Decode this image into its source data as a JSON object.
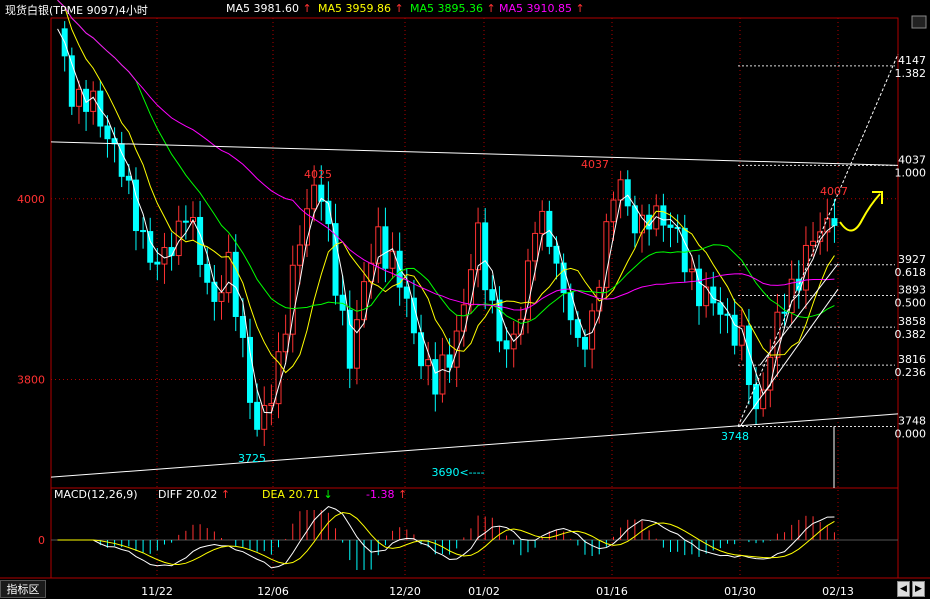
{
  "title": "现货白银(TPME 9097)4小时",
  "ma_readouts": [
    {
      "label": "MA5 3981.60",
      "color": "#ffffff"
    },
    {
      "label": "MA5 3959.86",
      "color": "#ffff00"
    },
    {
      "label": "MA5 3895.36",
      "color": "#00ff00"
    },
    {
      "label": "MA5 3910.85",
      "color": "#ff00ff"
    }
  ],
  "up_arrow": "↑",
  "down_arrow": "↓",
  "macd": {
    "label": "MACD(12,26,9)",
    "diff_label": "DIFF  20.02",
    "dea_label": "DEA  20.71",
    "macd_value": "-1.38",
    "zero_label": "0"
  },
  "bottom_tab": "指标区",
  "scroll_left": "◀",
  "scroll_right": "▶",
  "colors": {
    "up": "#ff3232",
    "down": "#00ffff",
    "axis": "#b00000",
    "annotation": "#ffff00"
  },
  "chart_data": {
    "type": "candlestick",
    "y_axis_labels": [
      4000,
      3800
    ],
    "ylim": [
      3680,
      4200
    ],
    "x_tick_labels": [
      "11/22",
      "12/06",
      "12/20",
      "01/02",
      "01/16",
      "01/30",
      "02/13"
    ],
    "price_annotations": [
      {
        "label": "4025",
        "color": "#ff3232"
      },
      {
        "label": "4037",
        "color": "#ff3232"
      },
      {
        "label": "4007",
        "color": "#ff3232"
      },
      {
        "label": "3725",
        "color": "#00ffff"
      },
      {
        "label": "3748",
        "color": "#00ffff"
      },
      {
        "label": "3690<----",
        "color": "#00ffff"
      }
    ],
    "fibonacci_levels": [
      {
        "price": "4147",
        "ratio": "1.382"
      },
      {
        "price": "4037",
        "ratio": "1.000"
      },
      {
        "price": "3927",
        "ratio": "0.618"
      },
      {
        "price": "3893",
        "ratio": "0.500"
      },
      {
        "price": "3858",
        "ratio": "0.382"
      },
      {
        "price": "3816",
        "ratio": "0.236"
      },
      {
        "price": "3748",
        "ratio": "0.000"
      }
    ],
    "close_keypoints": [
      [
        0,
        4180
      ],
      [
        2,
        4120
      ],
      [
        5,
        4100
      ],
      [
        8,
        4060
      ],
      [
        10,
        4000
      ],
      [
        12,
        3960
      ],
      [
        14,
        3920
      ],
      [
        16,
        3950
      ],
      [
        18,
        3990
      ],
      [
        20,
        3930
      ],
      [
        22,
        3890
      ],
      [
        24,
        3920
      ],
      [
        26,
        3840
      ],
      [
        28,
        3740
      ],
      [
        30,
        3780
      ],
      [
        32,
        3870
      ],
      [
        34,
        3950
      ],
      [
        36,
        4020
      ],
      [
        37,
        4010
      ],
      [
        39,
        3900
      ],
      [
        41,
        3830
      ],
      [
        43,
        3900
      ],
      [
        45,
        3960
      ],
      [
        47,
        3930
      ],
      [
        49,
        3880
      ],
      [
        51,
        3830
      ],
      [
        53,
        3790
      ],
      [
        55,
        3830
      ],
      [
        57,
        3880
      ],
      [
        59,
        3960
      ],
      [
        61,
        3880
      ],
      [
        63,
        3820
      ],
      [
        65,
        3880
      ],
      [
        67,
        3970
      ],
      [
        69,
        3960
      ],
      [
        71,
        3900
      ],
      [
        73,
        3830
      ],
      [
        75,
        3870
      ],
      [
        77,
        3960
      ],
      [
        79,
        4030
      ],
      [
        80,
        3990
      ],
      [
        82,
        3960
      ],
      [
        84,
        3990
      ],
      [
        86,
        3970
      ],
      [
        88,
        3930
      ],
      [
        90,
        3900
      ],
      [
        92,
        3880
      ],
      [
        94,
        3870
      ],
      [
        96,
        3840
      ],
      [
        98,
        3760
      ],
      [
        99,
        3800
      ],
      [
        101,
        3860
      ],
      [
        103,
        3900
      ],
      [
        105,
        3940
      ],
      [
        107,
        3960
      ],
      [
        109,
        3990
      ]
    ]
  }
}
